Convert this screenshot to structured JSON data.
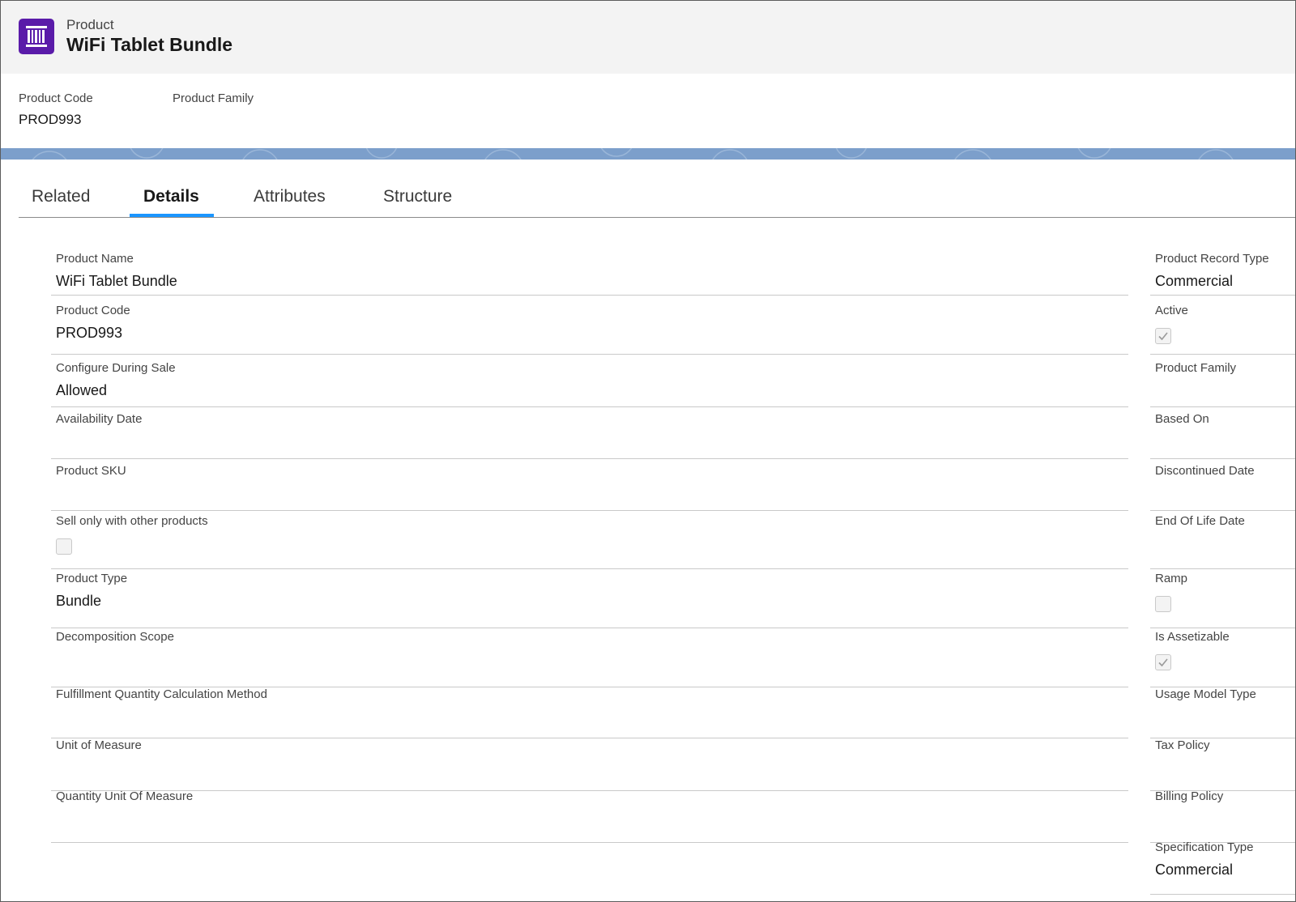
{
  "header": {
    "object_type": "Product",
    "title": "WiFi Tablet Bundle",
    "icon": "product-barcode-icon",
    "icon_color": "#5a1ba9"
  },
  "highlights": {
    "product_code_label": "Product Code",
    "product_code_value": "PROD993",
    "product_family_label": "Product Family",
    "product_family_value": ""
  },
  "tabs": [
    {
      "label": "Related",
      "active": false
    },
    {
      "label": "Details",
      "active": true
    },
    {
      "label": "Attributes",
      "active": false
    },
    {
      "label": "Structure",
      "active": false
    }
  ],
  "details": {
    "left": [
      {
        "label": "Product Name",
        "value": "WiFi Tablet Bundle",
        "type": "text"
      },
      {
        "label": "Product Code",
        "value": "PROD993",
        "type": "text"
      },
      {
        "label": "Configure During Sale",
        "value": "Allowed",
        "type": "text"
      },
      {
        "label": "Availability Date",
        "value": "",
        "type": "text"
      },
      {
        "label": "Product SKU",
        "value": "",
        "type": "text"
      },
      {
        "label": "Sell only with other products",
        "value": "",
        "checked": false,
        "type": "checkbox"
      },
      {
        "label": "Product Type",
        "value": "Bundle",
        "type": "text"
      },
      {
        "label": "Decomposition Scope",
        "value": "",
        "type": "text"
      },
      {
        "label": "Fulfillment Quantity Calculation Method",
        "value": "",
        "type": "text"
      },
      {
        "label": "Unit of Measure",
        "value": "",
        "type": "text"
      },
      {
        "label": "Quantity Unit Of Measure",
        "value": "",
        "type": "text"
      }
    ],
    "right": [
      {
        "label": "Product Record Type",
        "value": "Commercial",
        "type": "text"
      },
      {
        "label": "Active",
        "value": "",
        "checked": true,
        "type": "checkbox"
      },
      {
        "label": "Product Family",
        "value": "",
        "type": "text"
      },
      {
        "label": "Based On",
        "value": "",
        "type": "text"
      },
      {
        "label": "Discontinued Date",
        "value": "",
        "type": "text"
      },
      {
        "label": "End Of Life Date",
        "value": "",
        "type": "text"
      },
      {
        "label": "Ramp",
        "value": "",
        "checked": false,
        "type": "checkbox"
      },
      {
        "label": "Is Assetizable",
        "value": "",
        "checked": true,
        "type": "checkbox"
      },
      {
        "label": "Usage Model Type",
        "value": "",
        "type": "text"
      },
      {
        "label": "Tax Policy",
        "value": "",
        "type": "text"
      },
      {
        "label": "Billing Policy",
        "value": "",
        "type": "text"
      },
      {
        "label": "Specification Type",
        "value": "Commercial",
        "type": "text"
      }
    ]
  },
  "colors": {
    "accent": "#1b96ff",
    "band": "#7c9fcb"
  }
}
